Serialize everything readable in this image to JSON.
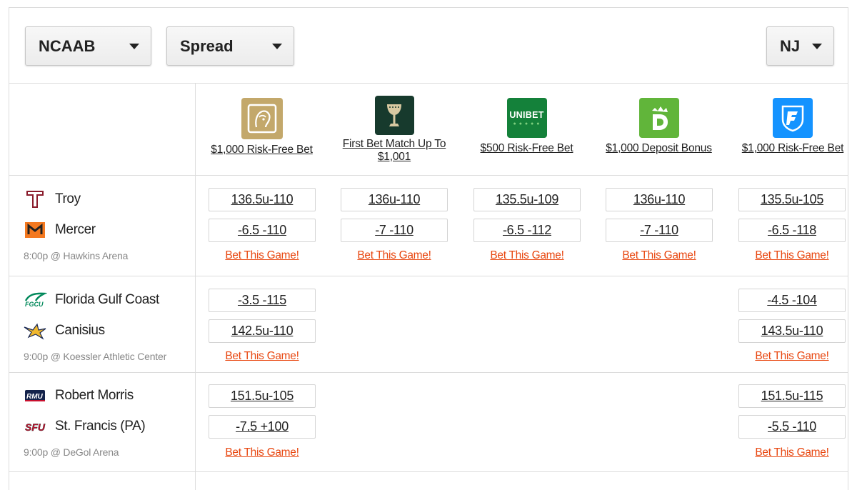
{
  "filters": {
    "league": "NCAAB",
    "market": "Spread",
    "state": "NJ"
  },
  "books": [
    {
      "name": "BetMGM",
      "icon": "betmgm-lion-logo",
      "color": "#c3a86b",
      "promo": "$1,000 Risk-Free Bet"
    },
    {
      "name": "Caesars",
      "icon": "caesars-chalice-logo",
      "color": "#173a2d",
      "promo": "First Bet Match Up To $1,001"
    },
    {
      "name": "Unibet",
      "icon": "unibet-logo",
      "color": "#14813a",
      "label": "UNIBET",
      "promo": "$500 Risk-Free Bet"
    },
    {
      "name": "DraftKings",
      "icon": "draftkings-crown-logo",
      "color": "#61b53a",
      "promo": "$1,000 Deposit Bonus"
    },
    {
      "name": "FanDuel",
      "icon": "fanduel-shield-logo",
      "color": "#1493ff",
      "promo": "$1,000 Risk-Free Bet"
    }
  ],
  "bet_label": "Bet This Game!",
  "games": [
    {
      "away": {
        "name": "Troy",
        "icon": "troy-logo",
        "color": "#8a1c2c"
      },
      "home": {
        "name": "Mercer",
        "icon": "mercer-logo",
        "color": "#f47920"
      },
      "info": "8:00p @ Hawkins Arena",
      "lines": [
        [
          "136.5u-110",
          "-6.5 -110"
        ],
        [
          "136u-110",
          "-7 -110"
        ],
        [
          "135.5u-109",
          "-6.5 -112"
        ],
        [
          "136u-110",
          "-7 -110"
        ],
        [
          "135.5u-105",
          "-6.5 -118"
        ]
      ]
    },
    {
      "away": {
        "name": "Florida Gulf Coast",
        "icon": "fgcu-logo",
        "color": "#00885a"
      },
      "home": {
        "name": "Canisius",
        "icon": "canisius-logo",
        "color": "#f1b82d"
      },
      "info": "9:00p @ Koessler Athletic Center",
      "lines": [
        [
          "-3.5 -115",
          "142.5u-110"
        ],
        null,
        null,
        null,
        [
          "-4.5 -104",
          "143.5u-110"
        ]
      ]
    },
    {
      "away": {
        "name": "Robert Morris",
        "icon": "rmu-logo",
        "color": "#14234b"
      },
      "home": {
        "name": "St. Francis (PA)",
        "icon": "sfu-logo",
        "color": "#c8102e"
      },
      "info": "9:00p @ DeGol Arena",
      "lines": [
        [
          "151.5u-105",
          "-7.5 +100"
        ],
        null,
        null,
        null,
        [
          "151.5u-115",
          "-5.5 -110"
        ]
      ]
    }
  ]
}
